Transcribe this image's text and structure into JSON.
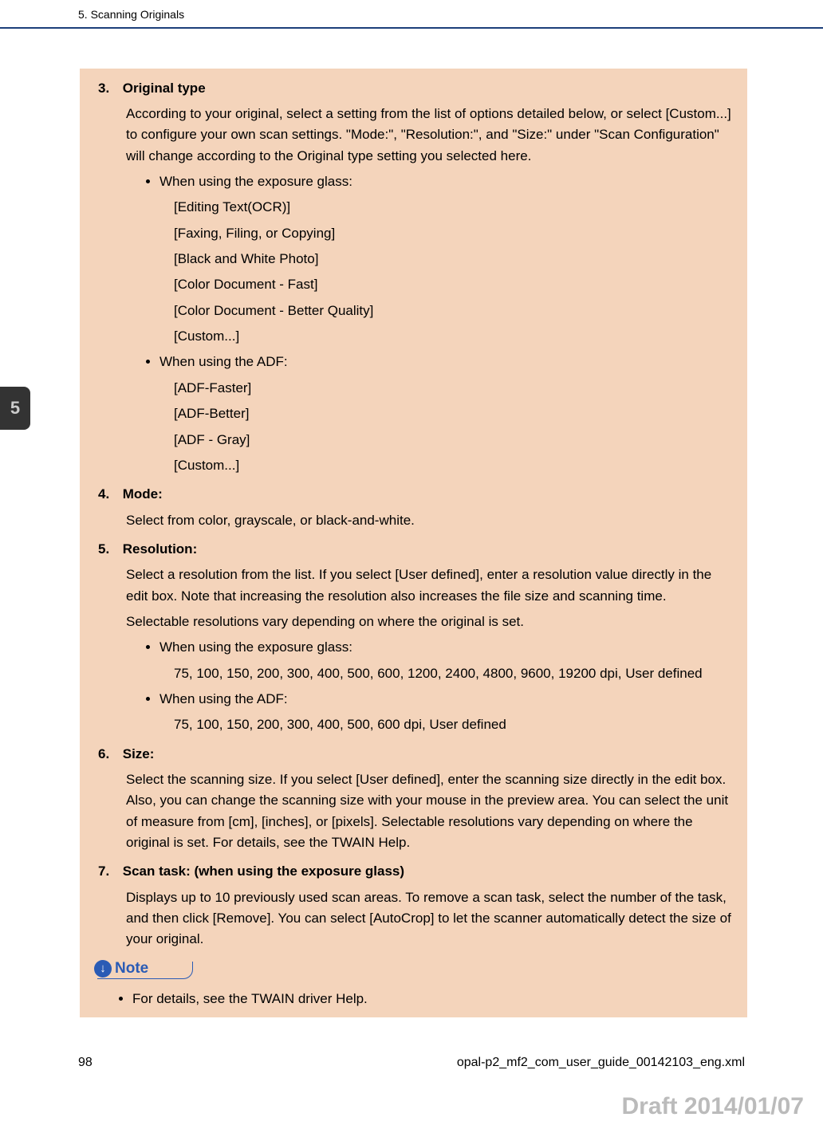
{
  "header": {
    "section_title": "5. Scanning Originals"
  },
  "chapter_tab": "5",
  "items": {
    "i3": {
      "num": "3.",
      "head": "Original type",
      "para1": "According to your original, select a setting from the list of options detailed below, or select [Custom...] to configure your own scan settings. \"Mode:\", \"Resolution:\", and \"Size:\" under \"Scan Configuration\" will change according to the Original type setting you selected here.",
      "bullet_a": "When using the exposure glass:",
      "a1": "[Editing Text(OCR)]",
      "a2": "[Faxing, Filing, or Copying]",
      "a3": "[Black and White Photo]",
      "a4": "[Color Document - Fast]",
      "a5": "[Color Document - Better Quality]",
      "a6": "[Custom...]",
      "bullet_b": "When using the ADF:",
      "b1": "[ADF-Faster]",
      "b2": "[ADF-Better]",
      "b3": "[ADF - Gray]",
      "b4": "[Custom...]"
    },
    "i4": {
      "num": "4.",
      "head": "Mode:",
      "para1": "Select from color, grayscale, or black-and-white."
    },
    "i5": {
      "num": "5.",
      "head": "Resolution:",
      "para1": "Select a resolution from the list. If you select [User defined], enter a resolution value directly in the edit box. Note that increasing the resolution also increases the file size and scanning time.",
      "para2": "Selectable resolutions vary depending on where the original is set.",
      "bullet_a": "When using the exposure glass:",
      "a1": "75, 100, 150, 200, 300, 400, 500, 600, 1200, 2400, 4800, 9600, 19200 dpi, User defined",
      "bullet_b": "When using the ADF:",
      "b1": "75, 100, 150, 200, 300, 400, 500, 600 dpi, User defined"
    },
    "i6": {
      "num": "6.",
      "head": "Size:",
      "para1": "Select the scanning size. If you select [User defined], enter the scanning size directly in the edit box. Also, you can change the scanning size with your mouse in the preview area. You can select the unit of measure from [cm], [inches], or [pixels]. Selectable resolutions vary depending on where the original is set. For details, see the TWAIN Help."
    },
    "i7": {
      "num": "7.",
      "head": "Scan task: (when using the exposure glass)",
      "para1": "Displays up to 10 previously used scan areas. To remove a scan task, select the number of the task, and then click [Remove]. You can select [AutoCrop] to let the scanner automatically detect the size of your original."
    }
  },
  "note_label": "Note",
  "note_text": "For details, see the TWAIN driver Help.",
  "footer": {
    "page_number": "98",
    "file_ref": "opal-p2_mf2_com_user_guide_00142103_eng.xml"
  },
  "watermark": "Draft 2014/01/07"
}
